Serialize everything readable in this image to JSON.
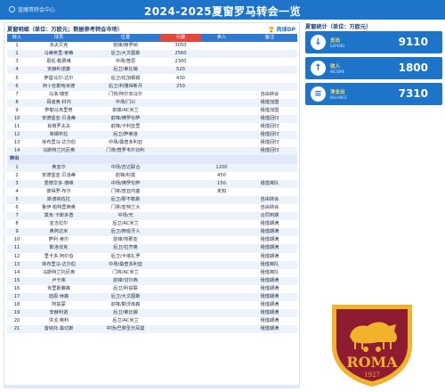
{
  "header": {
    "logo_text": "蓝魔哥转会中心",
    "title": "2024-2025夏窗罗马转会一览"
  },
  "table": {
    "title": "夏窗明细（单位：万欧元；数据参考转会市场）",
    "brand": "🏆 肉球DP",
    "columns": [
      "转入",
      "球员",
      "位置",
      "引援",
      "卖人",
      "备注"
    ],
    "rows_in": [
      [
        "1",
        "多夫贝克",
        "前锋/赫罗纳",
        "3050",
        "",
        ""
      ],
      [
        "2",
        "马蒂奥里-索蒂",
        "后卫/大文图斯",
        "2560",
        "",
        ""
      ],
      [
        "3",
        "恩佐·勒费维",
        "中场/普思",
        "2300",
        "",
        ""
      ],
      [
        "4",
        "安赫利诺康",
        "后卫/莱比锡",
        "520",
        "",
        ""
      ],
      [
        "5",
        "萨雷马尔-达尔",
        "后卫/佐加顿姆",
        "430",
        "",
        ""
      ],
      [
        "6",
        "阿卜杜勒哈米德",
        "后卫/利雅得新月",
        "250",
        "",
        ""
      ],
      [
        "7",
        "马洛·瑞安",
        "门将/阿尔克马尔",
        "",
        "",
        "自由转会"
      ],
      [
        "8",
        "哥迪奥·科内",
        "中场/门兴",
        "",
        "",
        "租借加盟"
      ],
      [
        "9",
        "萨勒马克里奇",
        "前锋/AC米兰",
        "",
        "",
        "租借加盟"
      ],
      [
        "10",
        "安德雷亚·贝洛蒂",
        "前锋/佛罗伦萨",
        "",
        "",
        "租借回归"
      ],
      [
        "11",
        "肖格罗夫夫",
        "前锋/卡利亚里",
        "",
        "",
        "租借回归"
      ],
      [
        "12",
        "库姆布拉",
        "后卫/萨索洛",
        "",
        "",
        "租借回归"
      ],
      [
        "13",
        "埃布里马·达尔伯",
        "中场/桑普多利亚",
        "",
        "",
        "租借回归"
      ],
      [
        "14",
        "马斯特兰托尼奥",
        "门将/普罗韦尔切利",
        "",
        "",
        "租借回归"
      ]
    ],
    "out_label": "转出",
    "rows_out": [
      [
        "1",
        "奥亚尔",
        "中场/吉达联合",
        "",
        "1200",
        ""
      ],
      [
        "2",
        "安德雷亚·贝洛蒂",
        "前锋/科莫",
        "",
        "450",
        ""
      ],
      [
        "3",
        "爱德华多·博维",
        "中场/佛罗伦萨",
        "",
        "150",
        "租借离队"
      ],
      [
        "4",
        "彼得罗·布尔",
        "门将/皮亚内塞",
        "",
        "未知",
        ""
      ],
      [
        "5",
        "斯波纳佐拉",
        "后卫/那不勒斯",
        "",
        "",
        "自由转会"
      ],
      [
        "6",
        "鲁伊·帕特里西奥",
        "门将/亚特兰大",
        "",
        "",
        "自由转会"
      ],
      [
        "7",
        "莫克·卡斯多普",
        "中场/无",
        "",
        "",
        "合同到期"
      ],
      [
        "8",
        "亚当拉尔",
        "后卫/AC米兰",
        "",
        "",
        "租借期满"
      ],
      [
        "9",
        "奥阿达米",
        "后卫/西班牙人",
        "",
        "",
        "租借期满"
      ],
      [
        "10",
        "萨利·索尔",
        "前锋/热那亚",
        "",
        "",
        "租借期满"
      ],
      [
        "11",
        "斯洛伐克",
        "后卫/拉齐奥",
        "",
        "",
        "租借期满"
      ],
      [
        "12",
        "里卡多·阿尔伯",
        "后卫/卡塔扎罗",
        "",
        "",
        "租借期满"
      ],
      [
        "13",
        "埃布里马·达尔伯",
        "中场/桑普多利亚",
        "",
        "",
        "租借离队"
      ],
      [
        "14",
        "马斯特兰托尼奥",
        "门将/AC米兰",
        "",
        "",
        "租借离队"
      ],
      [
        "15",
        "卢卡库",
        "前锋/切尔西",
        "",
        "",
        "租借期满"
      ],
      [
        "16",
        "克里斯滕森",
        "后卫/利兹联",
        "",
        "",
        "租借期满"
      ],
      [
        "17",
        "迪恩·休森",
        "后卫/大文图斯",
        "",
        "",
        "租借期满"
      ],
      [
        "18",
        "阿兹蒙",
        "前锋/勒沃库森",
        "",
        "",
        "租借期满"
      ],
      [
        "19",
        "安赫利诺",
        "后卫/莱比锡",
        "",
        "",
        "租借期满"
      ],
      [
        "20",
        "洪戈·奥利",
        "后卫/AC米兰",
        "",
        "",
        "租借期满"
      ],
      [
        "21",
        "雷纳托·桑切斯",
        "中场/巴黎圣日耳曼",
        "",
        "",
        "租借期满"
      ]
    ]
  },
  "stats": {
    "title": "夏窗统计（单位：万欧元）",
    "items": [
      {
        "label": "支出",
        "sub": "EXPEND",
        "value": "9110",
        "icon": "↓"
      },
      {
        "label": "收入",
        "sub": "INCOME",
        "value": "1800",
        "icon": "↑"
      },
      {
        "label": "净支出",
        "sub": "BALANCE",
        "value": "7310",
        "icon": "≡"
      }
    ]
  },
  "crest": {
    "wordmark": "ROMA",
    "year": "1927"
  },
  "colors": {
    "brand_blue": "#1e74c8",
    "header_red": "#e4473b",
    "crest_maroon": "#8e1b2f",
    "crest_gold": "#f1b22c"
  }
}
